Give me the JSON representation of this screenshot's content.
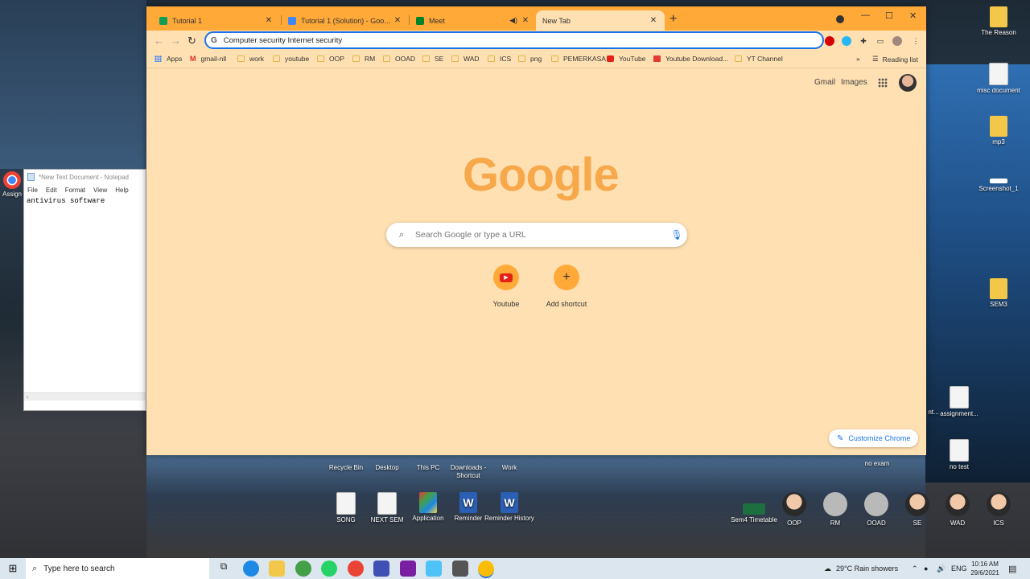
{
  "browser": {
    "tabs": [
      {
        "label": "Tutorial 1",
        "favicon_color": "#0f9d58"
      },
      {
        "label": "Tutorial 1 (Solution) - Google Do",
        "favicon_color": "#4285f4"
      },
      {
        "label": "Meet",
        "favicon_color": "#00832d"
      },
      {
        "label": "New Tab",
        "favicon_color": ""
      }
    ],
    "new_tab_symbol": "+",
    "close_symbol": "✕",
    "omnibox_text": "Computer security Internet security",
    "bookmarks": [
      {
        "label": "Apps",
        "icon": "apps-icon"
      },
      {
        "label": "gmail-nll",
        "icon": "gmail-icon"
      },
      {
        "label": "work",
        "icon": "folder-icon"
      },
      {
        "label": "youtube",
        "icon": "folder-icon"
      },
      {
        "label": "OOP",
        "icon": "folder-icon"
      },
      {
        "label": "RM",
        "icon": "folder-icon"
      },
      {
        "label": "OOAD",
        "icon": "folder-icon"
      },
      {
        "label": "SE",
        "icon": "folder-icon"
      },
      {
        "label": "WAD",
        "icon": "folder-icon"
      },
      {
        "label": "ICS",
        "icon": "folder-icon"
      },
      {
        "label": "png",
        "icon": "folder-icon"
      },
      {
        "label": "PEMERKASA",
        "icon": "folder-icon"
      },
      {
        "label": "YouTube",
        "icon": "youtube-icon"
      },
      {
        "label": "Youtube Download...",
        "icon": "download-icon"
      },
      {
        "label": "YT Channel",
        "icon": "folder-icon"
      }
    ],
    "more_bookmarks": "»",
    "reading_list": "Reading list",
    "ntp": {
      "gmail": "Gmail",
      "images": "Images",
      "logo": "Google",
      "search_placeholder": "Search Google or type a URL",
      "shortcuts": [
        {
          "label": "Youtube",
          "icon": "youtube-icon"
        },
        {
          "label": "Add shortcut",
          "icon": "plus-icon"
        }
      ],
      "customize": "Customize Chrome"
    }
  },
  "notepad": {
    "title": "*New Text Document - Notepad",
    "menu": [
      "File",
      "Edit",
      "Format",
      "View",
      "Help"
    ],
    "content": "antivirus software"
  },
  "desktop_icons_right": [
    {
      "label": "The Reason",
      "type": "folder"
    },
    {
      "label": "misc document",
      "type": "chrome"
    },
    {
      "label": "mp3",
      "type": "folder"
    },
    {
      "label": "Screenshot_1",
      "type": "file"
    },
    {
      "label": "SEM3",
      "type": "folder"
    },
    {
      "label": "nt...",
      "type": "file"
    },
    {
      "label": "assignment...",
      "type": "file"
    },
    {
      "label": "no exam",
      "type": "file"
    },
    {
      "label": "no test",
      "type": "file"
    }
  ],
  "desktop_icons_row1": [
    "Recycle Bin",
    "Desktop",
    "This PC",
    "Downloads - Shortcut",
    "Work"
  ],
  "desktop_icons_row2": [
    "SONG",
    "NEXT SEM",
    "Application",
    "Reminder",
    "Reminder History"
  ],
  "desktop_people": [
    "Sem4 Timetable",
    "OOP",
    "RM",
    "OOAD",
    "SE",
    "WAD",
    "ICS"
  ],
  "desktop_left_label": "Assign",
  "taskbar": {
    "search_placeholder": "Type here to search",
    "weather": "29°C  Rain showers",
    "lang": "ENG",
    "time": "10:16 AM",
    "date": "29/6/2021"
  }
}
